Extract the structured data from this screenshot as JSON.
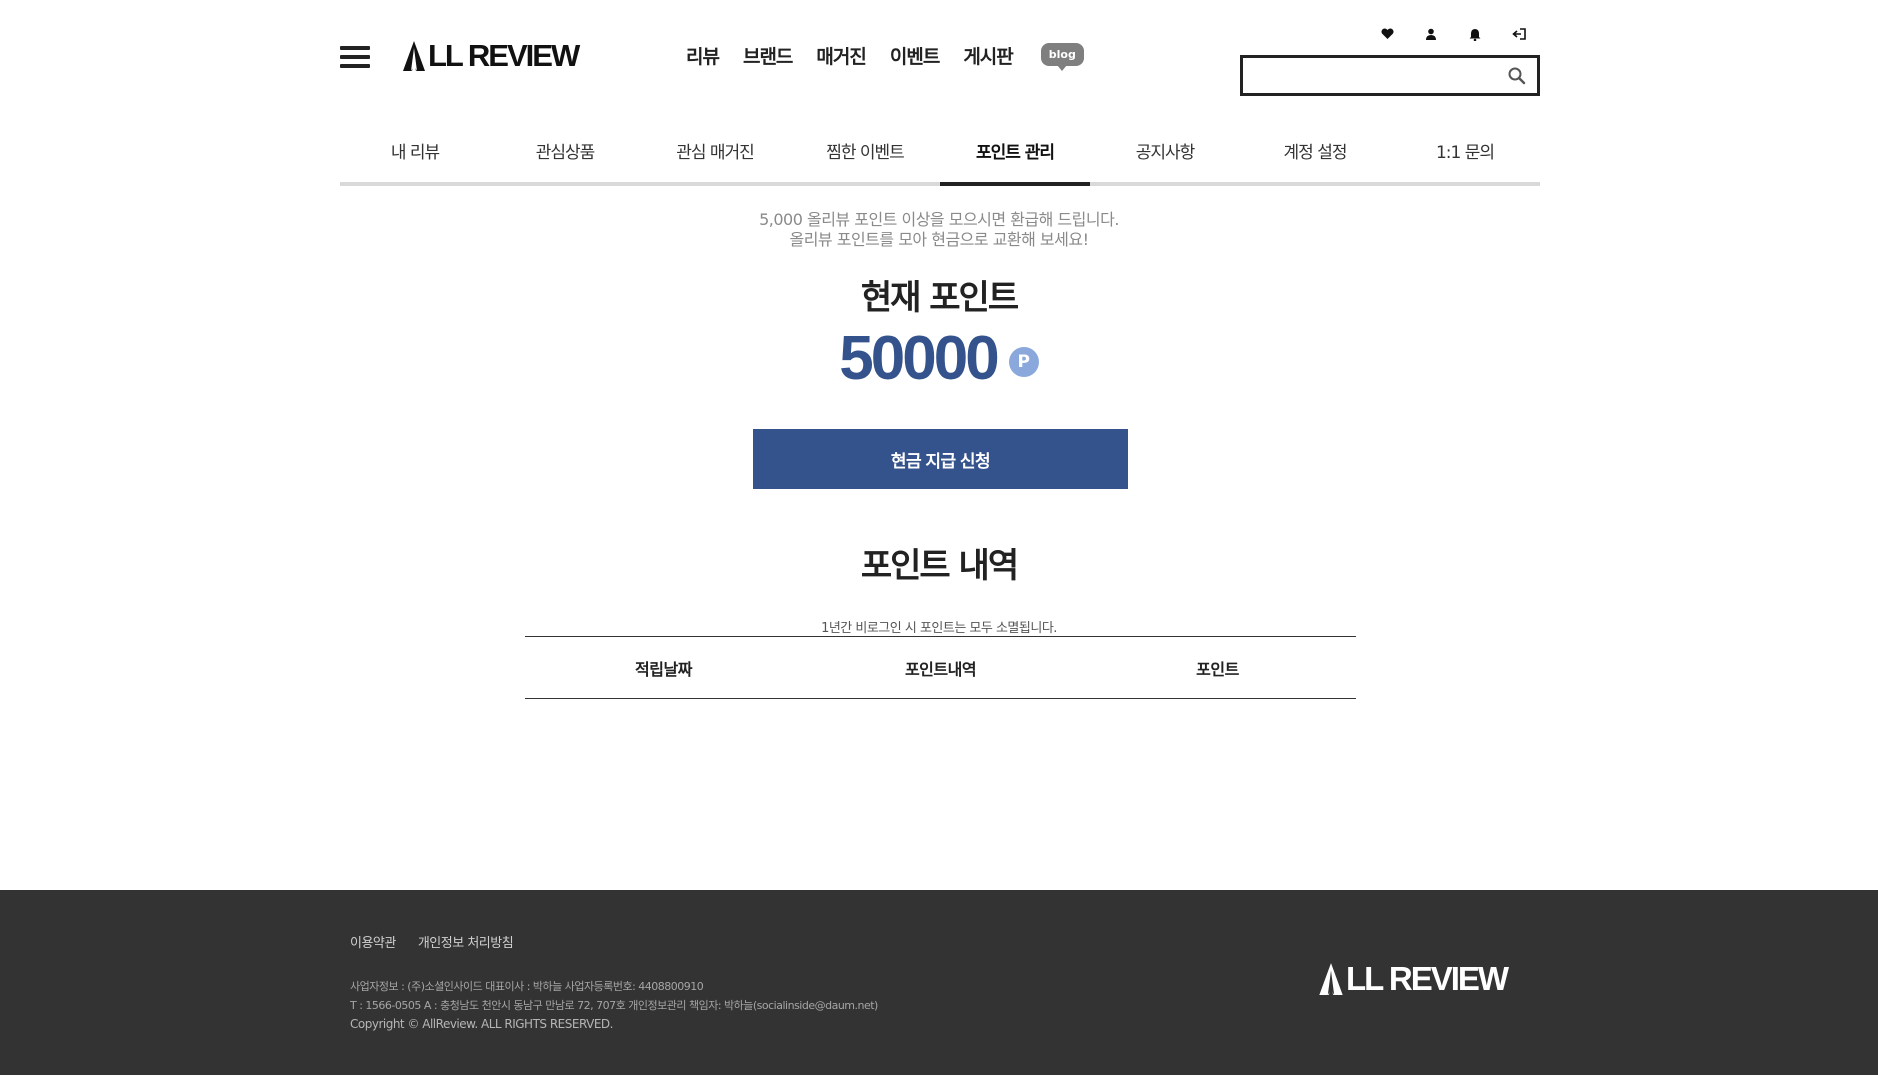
{
  "header": {
    "logo_text": "LL REVIEW",
    "nav": [
      "리뷰",
      "브랜드",
      "매거진",
      "이벤트",
      "게시판"
    ],
    "blog_label": "blog",
    "search": {
      "value": "",
      "placeholder": ""
    }
  },
  "tabs": [
    {
      "label": "내 리뷰"
    },
    {
      "label": "관심상품"
    },
    {
      "label": "관심 매거진"
    },
    {
      "label": "찜한 이벤트"
    },
    {
      "label": "포인트 관리"
    },
    {
      "label": "공지사항"
    },
    {
      "label": "계정 설정"
    },
    {
      "label": "1:1 문의"
    }
  ],
  "active_tab": "포인트 관리",
  "content": {
    "notice_line1": "5,000 올리뷰 포인트 이상을 모으시면 환급해 드립니다.",
    "notice_line2": "올리뷰 포인트를 모아 현금으로 교환해 보세요!",
    "current_title": "현재 포인트",
    "points": "50000",
    "points_badge": "P",
    "cash_button": "현금 지급 신청",
    "history_title": "포인트 내역",
    "expire_note": "1년간 비로그인 시 포인트는 모두 소멸됩니다.",
    "table_headers": [
      "적립날짜",
      "포인트내역",
      "포인트"
    ]
  },
  "footer": {
    "links": [
      "이용약관",
      "개인정보 처리방침"
    ],
    "info_line1": "사업자정보 : (주)소셜인사이드 대표이사 : 박하늘 사업자등록번호: 4408800910",
    "info_line2": "T : 1566-0505 A : 충청남도 천안시 동남구 만남로 72, 707호 개인정보관리 책임자: 박하늘(socialinside@daum.net)",
    "copyright": "Copyright © AllReview.     ALL RIGHTS RESERVED.",
    "logo_text": "LL REVIEW"
  },
  "colors": {
    "accent": "#34538c",
    "badge": "#8ba8dd",
    "footer_bg": "#333333"
  },
  "icons": [
    "menu-icon",
    "heart-icon",
    "user-icon",
    "bell-icon",
    "logout-icon",
    "search-icon"
  ]
}
